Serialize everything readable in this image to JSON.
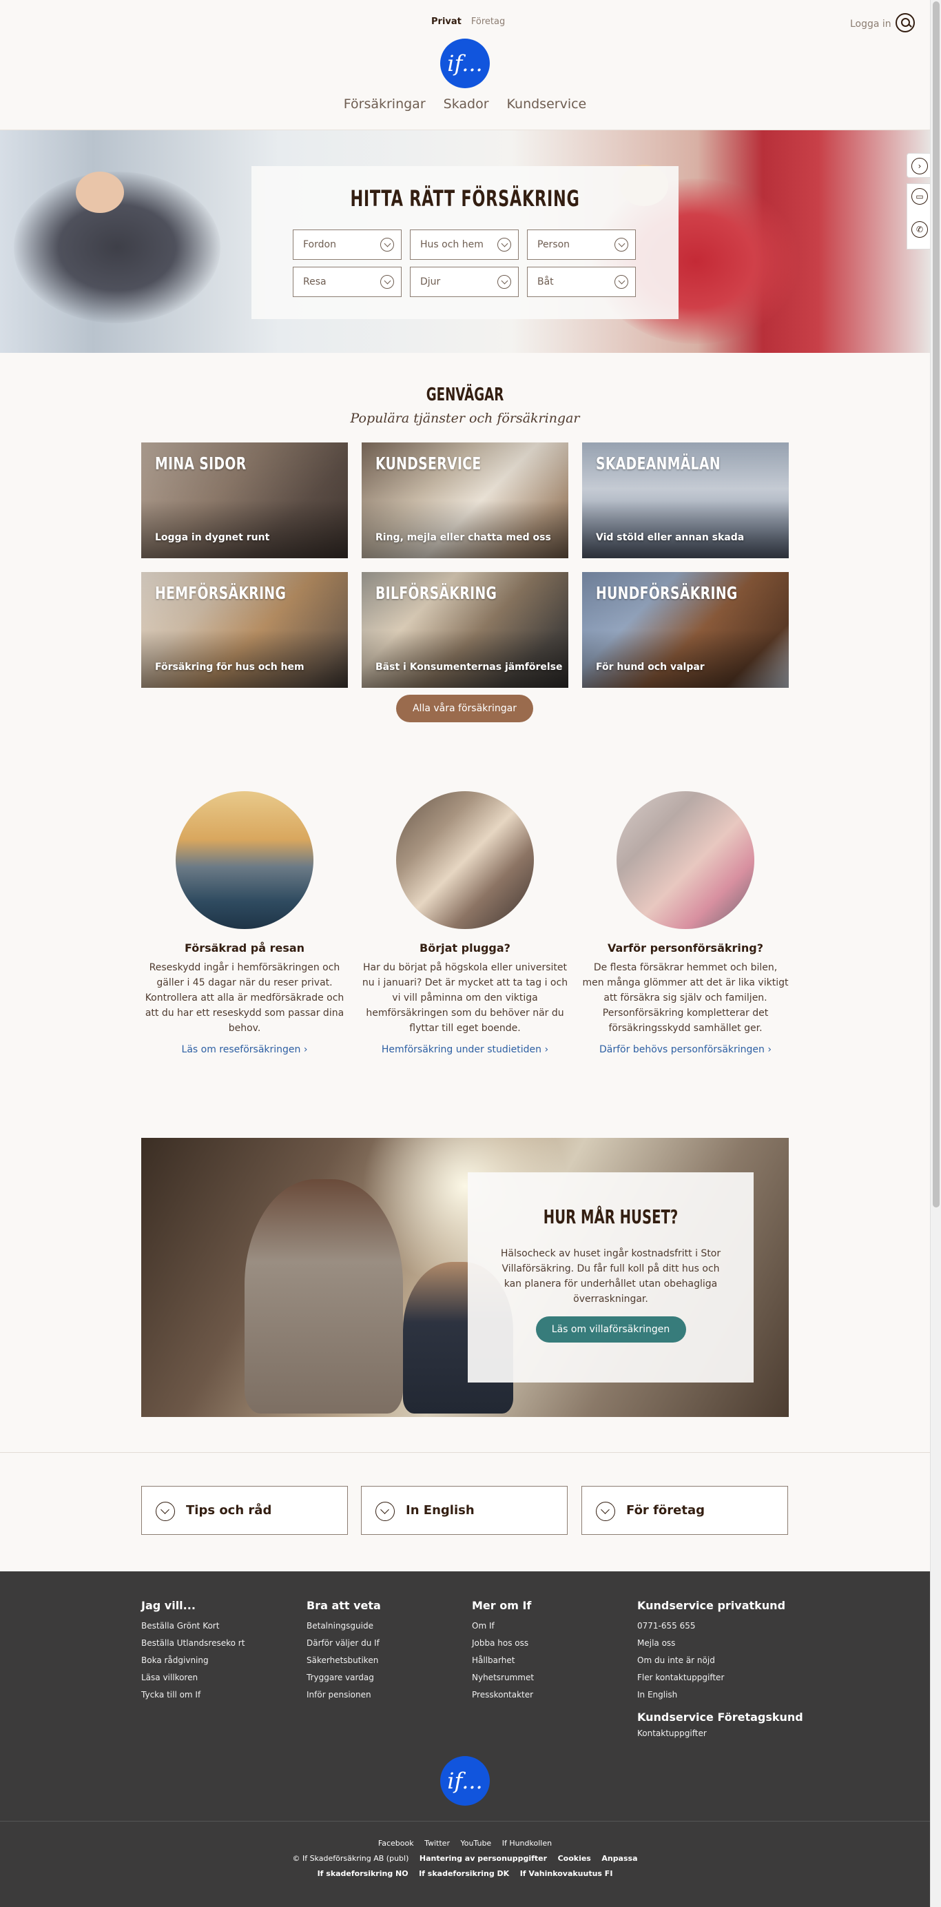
{
  "header": {
    "segment_private": "Privat",
    "segment_business": "Företag",
    "login": "Logga in",
    "logo_text": "if...",
    "nav": [
      "Försäkringar",
      "Skador",
      "Kundservice"
    ]
  },
  "hero": {
    "title": "HITTA RÄTT FÖRSÄKRING",
    "selects": [
      "Fordon",
      "Hus och hem",
      "Person",
      "Resa",
      "Djur",
      "Båt"
    ]
  },
  "shortcuts": {
    "title": "GENVÄGAR",
    "subtitle": "Populära tjänster och försäkringar",
    "cards": [
      {
        "title": "MINA SIDOR",
        "sub": "Logga in dygnet runt"
      },
      {
        "title": "KUNDSERVICE",
        "sub": "Ring, mejla eller chatta med oss"
      },
      {
        "title": "SKADEANMÄLAN",
        "sub": "Vid stöld eller annan skada"
      },
      {
        "title": "HEMFÖRSÄKRING",
        "sub": "Försäkring för hus och hem"
      },
      {
        "title": "BILFÖRSÄKRING",
        "sub": "Bäst i Konsumenternas jämförelse"
      },
      {
        "title": "HUNDFÖRSÄKRING",
        "sub": "För hund och valpar"
      }
    ],
    "all_button": "Alla våra försäkringar"
  },
  "features": [
    {
      "title": "Försäkrad på resan",
      "text": "Reseskydd ingår i hemförsäkringen och gäller i 45 dagar när du reser privat. Kontrollera att alla är medförsäkrade och att du har ett reseskydd som passar dina behov.",
      "link": "Läs om reseförsäkringen"
    },
    {
      "title": "Börjat plugga?",
      "text": "Har du börjat på högskola eller universitet nu i januari? Det är mycket att ta tag i och vi vill påminna om den viktiga hemförsäkringen som du behöver när du flyttar till eget boende.",
      "link": "Hemförsäkring under studietiden"
    },
    {
      "title": "Varför personförsäkring?",
      "text": "De flesta försäkrar hemmet och bilen, men många glömmer att det är lika viktigt att försäkra sig själv och familjen. Personförsäkring kompletterar det försäkringsskydd samhället ger.",
      "link": "Därför behövs personförsäkringen"
    }
  ],
  "promo": {
    "title": "HUR MÅR HUSET?",
    "text": "Hälsocheck av huset ingår kostnadsfritt i Stor Villaförsäkring. Du får full koll på ditt hus och kan planera för underhållet utan obehagliga överraskningar.",
    "button": "Läs om villaförsäkringen"
  },
  "accordions": [
    "Tips och råd",
    "In English",
    "För företag"
  ],
  "footer": {
    "columns": [
      {
        "title": "Jag vill...",
        "links": [
          "Beställa Grönt Kort",
          "Beställa Utlandsreseko rt",
          "Boka rådgivning",
          "Läsa villkoren",
          "Tycka till om If"
        ]
      },
      {
        "title": "Bra att veta",
        "links": [
          "Betalningsguide",
          "Därför väljer du If",
          "Säkerhetsbutiken",
          "Tryggare vardag",
          "Inför pensionen"
        ]
      },
      {
        "title": "Mer om If",
        "links": [
          "Om If",
          "Jobba hos oss",
          "Hållbarhet",
          "Nyhetsrummet",
          "Presskontakter"
        ]
      },
      {
        "title": "Kundservice privatkund",
        "links": [
          "0771-655 655",
          "Mejla oss",
          "Om du inte är nöjd",
          "Fler kontaktuppgifter",
          "In English"
        ]
      }
    ],
    "business_title": "Kundservice Företagskund",
    "business_link": "Kontaktuppgifter",
    "logo_text": "if...",
    "social": [
      "Facebook",
      "Twitter",
      "YouTube",
      "If Hundkollen"
    ],
    "copyright": "© If Skadeförsäkring AB (publ)",
    "legal": [
      "Hantering av personuppgifter",
      "Cookies",
      "Anpassa"
    ],
    "countries": [
      "If skadeforsikring NO",
      "If skadeforsikring DK",
      "If Vahinkovakuutus FI"
    ]
  }
}
